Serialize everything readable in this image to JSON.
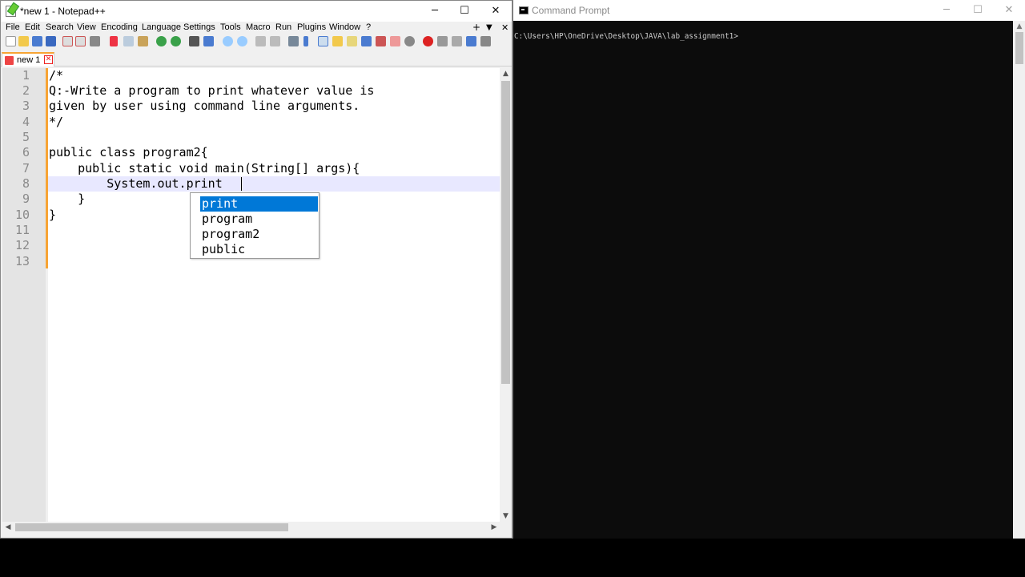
{
  "notepad": {
    "title": "*new 1 - Notepad++",
    "window_buttons": {
      "minimize": "─",
      "maximize": "☐",
      "close": "✕"
    },
    "menu": [
      "File",
      "Edit",
      "Search",
      "View",
      "Encoding",
      "Language",
      "Settings",
      "Tools",
      "Macro",
      "Run",
      "Plugins",
      "Window",
      "?"
    ],
    "menu_right": {
      "add": "+",
      "dropdown": "▼",
      "close": "✕"
    },
    "tab": {
      "label": "new 1",
      "close": "✕"
    },
    "line_numbers": [
      "1",
      "2",
      "3",
      "4",
      "5",
      "6",
      "7",
      "8",
      "9",
      "10",
      "11",
      "12",
      "13"
    ],
    "code_lines": [
      "/*",
      "Q:-Write a program to print whatever value is",
      "given by user using command line arguments.",
      "*/",
      "",
      "public class program2{",
      "    public static void main(String[] args){",
      "        System.out.print",
      "    }",
      "}",
      "",
      "",
      ""
    ],
    "autocomplete": {
      "items": [
        "print",
        "program",
        "program2",
        "public"
      ],
      "selected": "print",
      "selection_color": "#0078d7"
    },
    "current_line": 8,
    "accent_color": "#f7a434"
  },
  "cmd": {
    "title": "Command Prompt",
    "window_buttons": {
      "minimize": "─",
      "maximize": "☐",
      "close": "✕"
    },
    "prompt": "C:\\Users\\HP\\OneDrive\\Desktop\\JAVA\\lab_assignment1>"
  }
}
